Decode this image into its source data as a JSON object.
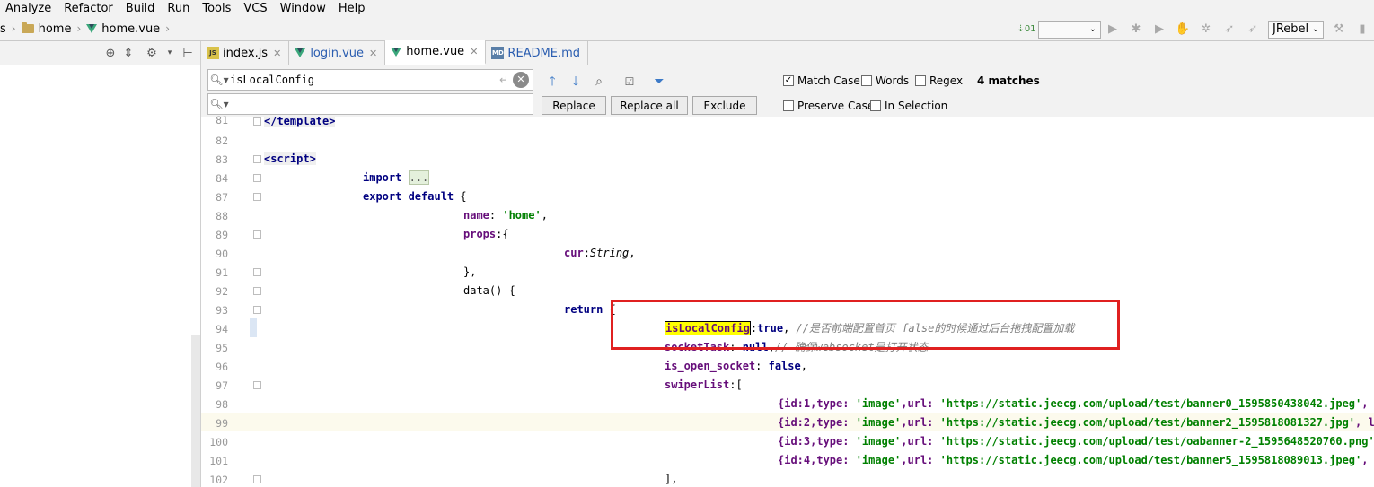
{
  "menu": [
    "Analyze",
    "Refactor",
    "Build",
    "Run",
    "Tools",
    "VCS",
    "Window",
    "Help"
  ],
  "breadcrumb": {
    "first_partial": "s",
    "folder": "home",
    "file": "home.vue"
  },
  "run_toolbar": {
    "config_value": "",
    "jrebel": "JRebel"
  },
  "tabs": [
    {
      "label": "index.js",
      "icon": "js-file-icon",
      "icon_text": "JS",
      "active": false
    },
    {
      "label": "login.vue",
      "icon": "vue-file-icon",
      "active": false
    },
    {
      "label": "home.vue",
      "icon": "vue-file-icon",
      "active": true
    },
    {
      "label": "README.md",
      "icon": "md-file-icon",
      "icon_text": "MD",
      "active": false
    }
  ],
  "find": {
    "search_value": "isLocalConfig",
    "replace_value": "",
    "replace_label": "Replace",
    "replace_all_label": "Replace all",
    "exclude_label": "Exclude",
    "match_case": "Match Case",
    "words": "Words",
    "regex": "Regex",
    "preserve_case": "Preserve Case",
    "in_selection": "In Selection",
    "matches": "4 matches"
  },
  "gutter": [
    "81",
    "82",
    "83",
    "84",
    "87",
    "88",
    "89",
    "90",
    "91",
    "92",
    "93",
    "94",
    "95",
    "96",
    "97",
    "98",
    "99",
    "100",
    "101",
    "102"
  ],
  "code": {
    "l81": "</template>",
    "l83": "<script>",
    "l84_kw": "import",
    "l84_dots": "...",
    "l87_kw": "export default",
    "l87_rest": " {",
    "l88_prop": "name",
    "l88_str": "'home'",
    "l89_prop": "props",
    "l89_rest": ":{",
    "l90_prop": "cur",
    "l90_type": "String",
    "l91": "},",
    "l92": "data() {",
    "l93_kw": "return",
    "l93_rest": " {",
    "l94_match": "isLocalConfig",
    "l94_kw": "true",
    "l94_cmt": "//是否前端配置首页 false的时候通过后台拖拽配置加载",
    "l95_prop": "socketTask",
    "l95_kw": "null",
    "l95_cmt": "// 确保websocket是打开状态",
    "l96_prop": "is_open_socket",
    "l96_kw": "false",
    "l97_prop": "swiperList",
    "l97_rest": ":[",
    "l98_id": "{id:1,type: ",
    "l98_str1": "'image'",
    "l98_mid": ",url: ",
    "l98_str2": "'https://static.jeecg.com/upload/test/banner0_1595850438042.jpeg'",
    "l98_tail": ", lin",
    "l99_id": "{id:2,type: ",
    "l99_str1": "'image'",
    "l99_mid": ",url: ",
    "l99_str2": "'https://static.jeecg.com/upload/test/banner2_1595818081327.jpg'",
    "l99_tail": ", link",
    "l100_id": "{id:3,type: ",
    "l100_str1": "'image'",
    "l100_mid": ",url: ",
    "l100_str2": "'https://static.jeecg.com/upload/test/oabanner-2_1595648520760.png'",
    "l100_tail": ", l",
    "l101_id": "{id:4,type: ",
    "l101_str1": "'image'",
    "l101_mid": ",url: ",
    "l101_str2": "'https://static.jeecg.com/upload/test/banner5_1595818089013.jpeg'",
    "l101_tail": ", lin",
    "l102": "],"
  },
  "colors": {
    "annotation": "#e02020",
    "match_highlight": "#ffff00"
  }
}
